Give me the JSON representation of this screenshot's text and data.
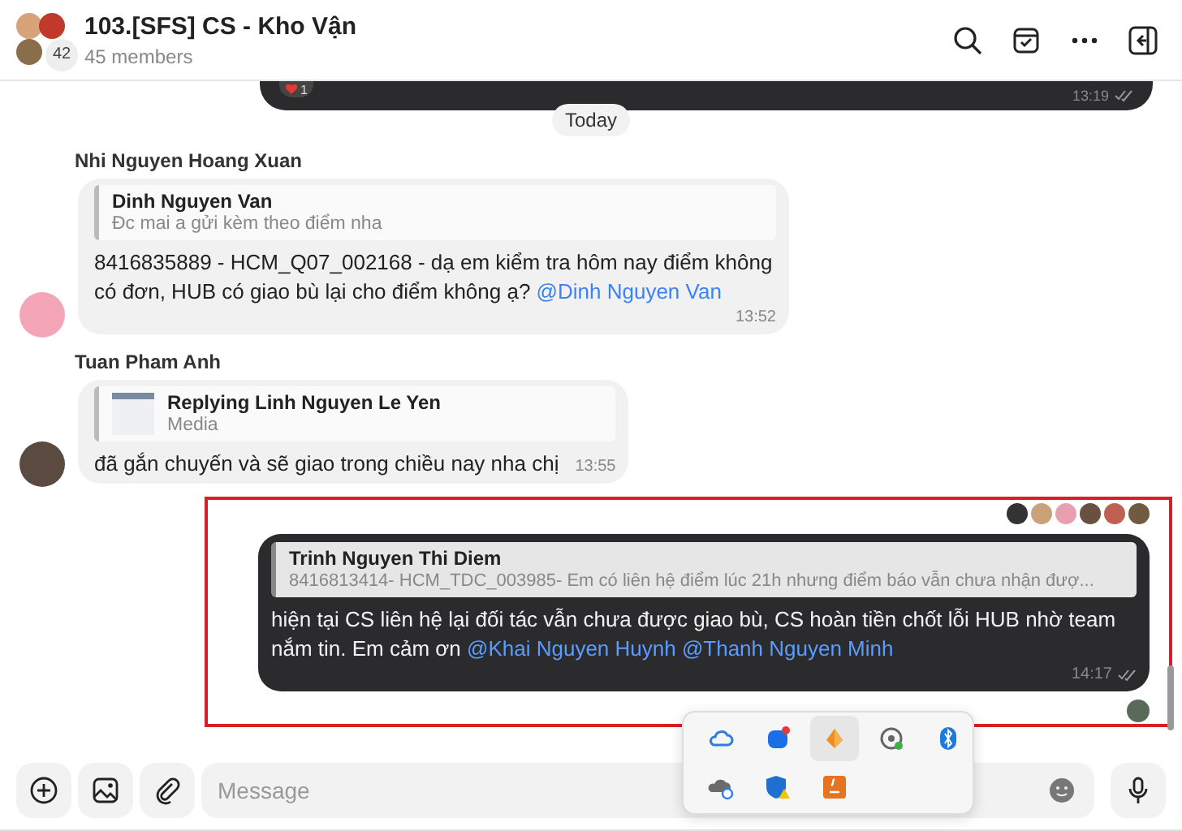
{
  "header": {
    "title": "103.[SFS] CS - Kho Vận",
    "members": "45 members",
    "avatar_count": "42"
  },
  "previous_message": {
    "reaction_count": "1",
    "time": "13:19",
    "read": true
  },
  "date_divider": "Today",
  "messages": [
    {
      "kind": "incoming",
      "sender": "Nhi Nguyen Hoang Xuan",
      "reply": {
        "kind": "text",
        "author": "Dinh Nguyen Van",
        "text": "Đc mai a gửi kèm theo điểm nha"
      },
      "parts": [
        {
          "text": "8416835889 - HCM_Q07_002168 - dạ em kiểm tra hôm nay điểm không có đơn, HUB có giao bù lại cho điểm không ạ? ",
          "mention": false
        },
        {
          "text": "@Dinh Nguyen Van",
          "mention": true
        }
      ],
      "time": "13:52",
      "highlighted": false
    },
    {
      "kind": "incoming",
      "sender": "Tuan Pham Anh",
      "reply": {
        "kind": "media",
        "author": "Replying Linh Nguyen Le Yen",
        "text": "Media"
      },
      "parts": [
        {
          "text": "đã gắn chuyến và sẽ giao trong chiều nay nha chị",
          "mention": false
        }
      ],
      "time": "13:55",
      "highlighted": false
    },
    {
      "kind": "outgoing",
      "reply": {
        "kind": "text",
        "author": "Trinh Nguyen Thi Diem",
        "text": "8416813414- HCM_TDC_003985- Em có liên hệ điểm lúc 21h nhưng điểm báo vẫn chưa nhận đượ..."
      },
      "parts": [
        {
          "text": "hiện tại CS liên hệ lại đối tác vẫn chưa được giao bù, CS hoàn tiền chốt lỗi HUB nhờ team nắm tin. Em cảm ơn ",
          "mention": false
        },
        {
          "text": "@Khai Nguyen Huynh",
          "mention": true
        },
        {
          "text": " @Thanh Nguyen Minh",
          "mention": true
        }
      ],
      "time": "14:17",
      "read": true,
      "highlighted": true
    }
  ],
  "composer": {
    "placeholder": "Message"
  },
  "tray_popup": {
    "items": [
      {
        "kind": "cloud",
        "selected": false
      },
      {
        "kind": "chat-app",
        "selected": false
      },
      {
        "kind": "orange-app",
        "selected": true
      },
      {
        "kind": "broadcast",
        "selected": false
      },
      {
        "kind": "bluetooth",
        "selected": false
      },
      {
        "kind": "cloud-sync",
        "selected": false
      },
      {
        "kind": "shield",
        "selected": false
      },
      {
        "kind": "java",
        "selected": false
      }
    ]
  }
}
